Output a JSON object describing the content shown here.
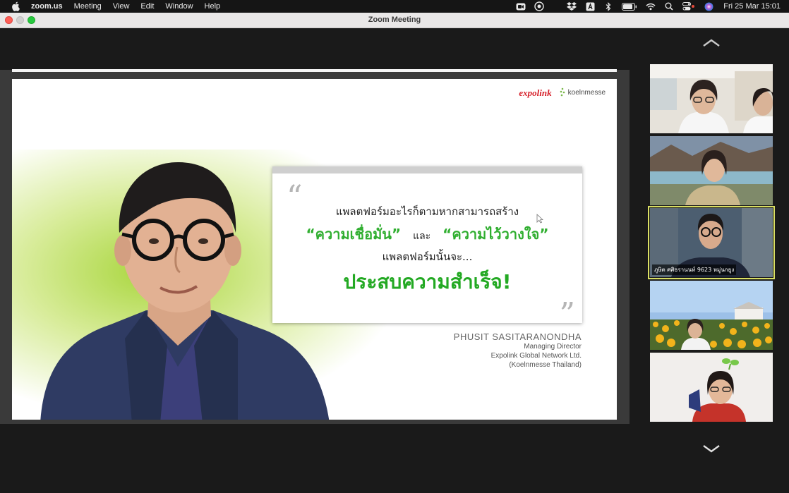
{
  "menubar": {
    "app_name": "zoom.us",
    "items": [
      "Meeting",
      "View",
      "Edit",
      "Window",
      "Help"
    ],
    "clock": "Fri 25 Mar  15:01",
    "tray_icons": [
      "zoom-video-icon",
      "screen-record-icon",
      "dropbox-icon",
      "input-source-icon",
      "bluetooth-icon",
      "battery-icon",
      "wifi-icon",
      "spotlight-search-icon",
      "control-center-icon",
      "siri-icon"
    ]
  },
  "window": {
    "title": "Zoom Meeting"
  },
  "slide": {
    "logo_expolink": "expolink",
    "logo_koeln": "koelnmesse",
    "quote": {
      "line1": "แพลตฟอร์มอะไรก็ตามหากสามารถสร้าง",
      "line2_a": "“ความเชื่อมั่น”",
      "line2_and": "และ",
      "line2_b": "“ความไว้วางใจ”",
      "line3": "แพลตฟอร์มนั้นจะ...",
      "line4": "ประสบความสำเร็จ!"
    },
    "credit": {
      "name": "PHUSIT SASITARANONDHA",
      "title": "Managing Director",
      "company": "Expolink Global Network Ltd.",
      "affiliate": "(Koelnmesse Thailand)"
    }
  },
  "gallery": {
    "tiles": [
      {
        "name": ""
      },
      {
        "name": ""
      },
      {
        "name": "ภูษิต ศศิธรานนท์ 9623 หมู่นกยูง"
      },
      {
        "name": ""
      },
      {
        "name": ""
      }
    ]
  }
}
